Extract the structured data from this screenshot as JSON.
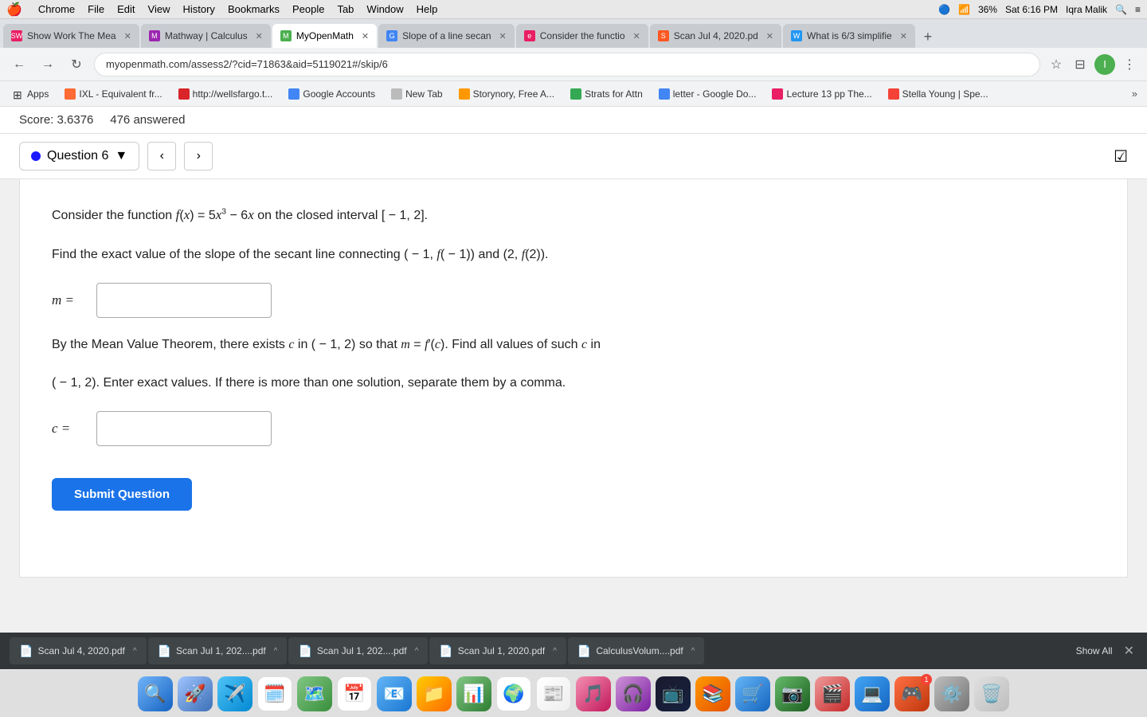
{
  "menubar": {
    "apple": "🍎",
    "items": [
      "Chrome",
      "File",
      "Edit",
      "View",
      "History",
      "Bookmarks",
      "People",
      "Tab",
      "Window",
      "Help"
    ],
    "right": {
      "bluetooth": "🔵",
      "wifi": "📶",
      "battery": "36%",
      "datetime": "Sat 6:16 PM",
      "user": "Iqra Malik",
      "search_icon": "🔍"
    }
  },
  "tabs": [
    {
      "id": 1,
      "label": "Show Work The Mea",
      "active": false,
      "favicon": "SW"
    },
    {
      "id": 2,
      "label": "Mathway | Calculus",
      "active": false,
      "favicon": "M"
    },
    {
      "id": 3,
      "label": "MyOpenMath",
      "active": true,
      "favicon": "M"
    },
    {
      "id": 4,
      "label": "Slope of a line secan",
      "active": false,
      "favicon": "G"
    },
    {
      "id": 5,
      "label": "Consider the functio",
      "active": false,
      "favicon": "e"
    },
    {
      "id": 6,
      "label": "Scan Jul 4, 2020.pd",
      "active": false,
      "favicon": "S"
    },
    {
      "id": 7,
      "label": "What is 6/3 simplifie",
      "active": false,
      "favicon": "W"
    }
  ],
  "addressbar": {
    "url": "myopenmath.com/assess2/?cid=71863&aid=5119021#/skip/6",
    "back": "←",
    "forward": "→",
    "refresh": "↻"
  },
  "bookmarks": [
    {
      "id": "apps",
      "label": "Apps",
      "favicon": "⊞"
    },
    {
      "id": "ixl",
      "label": "IXL - Equivalent fr...",
      "favicon": "I"
    },
    {
      "id": "wellsfargo",
      "label": "http://wellsfargo.t...",
      "favicon": "W"
    },
    {
      "id": "google-accounts",
      "label": "Google Accounts",
      "favicon": "G"
    },
    {
      "id": "new-tab",
      "label": "New Tab",
      "favicon": "+"
    },
    {
      "id": "storynory",
      "label": "Storynory, Free A...",
      "favicon": "S"
    },
    {
      "id": "strats",
      "label": "Strats for Attn",
      "favicon": "S"
    },
    {
      "id": "letter",
      "label": "letter - Google Do...",
      "favicon": "L"
    },
    {
      "id": "lecture",
      "label": "Lecture 13 pp The...",
      "favicon": "L"
    },
    {
      "id": "stella",
      "label": "Stella Young | Spe...",
      "favicon": "S"
    }
  ],
  "score": {
    "label": "Score: 3.6376",
    "answered": "476 answered"
  },
  "question_nav": {
    "question_label": "Question 6",
    "dropdown_arrow": "▼",
    "back_arrow": "‹",
    "forward_arrow": "›",
    "check_icon": "☑"
  },
  "problem": {
    "line1": "Consider the function f(x) = 5x³ − 6x on the closed interval [ − 1, 2].",
    "line2": "Find the exact value of the slope of the secant line connecting ( − 1, f( − 1)) and (2, f(2)).",
    "m_label": "m =",
    "m_placeholder": "",
    "line3": "By the Mean Value Theorem, there exists c in ( − 1, 2) so that m = f′(c). Find all values of such c in",
    "line4": "( − 1, 2). Enter exact values. If there is more than one solution, separate them by a comma.",
    "c_label": "c =",
    "c_placeholder": ""
  },
  "submit_button": "Submit Question",
  "downloads": [
    {
      "id": "dl1",
      "label": "Scan Jul 4, 2020.pdf"
    },
    {
      "id": "dl2",
      "label": "Scan Jul 1, 202....pdf"
    },
    {
      "id": "dl3",
      "label": "Scan Jul 1, 202....pdf"
    },
    {
      "id": "dl4",
      "label": "Scan Jul 1, 2020.pdf"
    },
    {
      "id": "dl5",
      "label": "CalculusVolum....pdf"
    }
  ],
  "show_all_label": "Show All",
  "dock_icons": [
    "🔍",
    "🌐",
    "✈️",
    "🗓️",
    "🗺️",
    "📅",
    "📧",
    "📁",
    "📊",
    "🌍",
    "📰",
    "🎵",
    "🎧",
    "📺",
    "📚",
    "🛒",
    "📷",
    "🎬",
    "💻",
    "🎮",
    "⚙️",
    "🗑️"
  ]
}
